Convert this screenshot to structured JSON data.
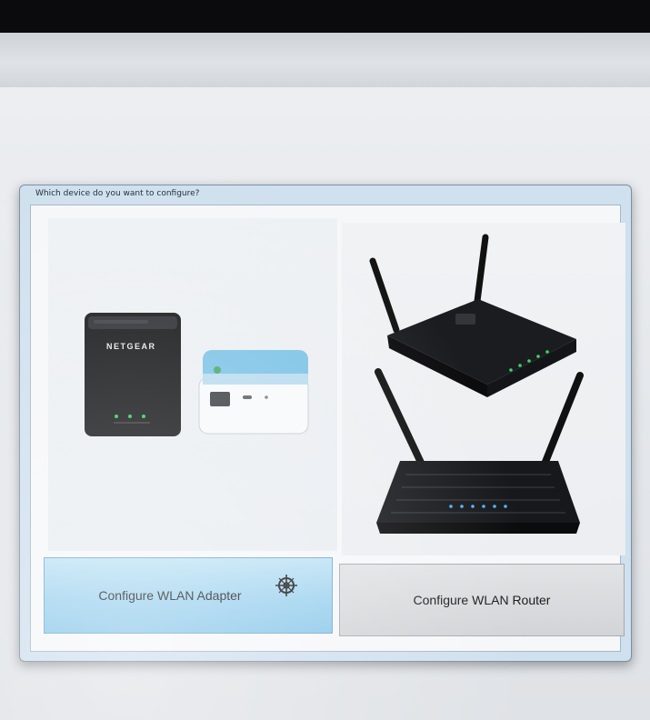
{
  "dialog": {
    "title": "Which device do you want to configure?"
  },
  "options": {
    "adapter_label": "Configure WLAN Adapter",
    "router_label": "Configure WLAN Router",
    "adapter_brand_text": "NETGEAR"
  },
  "icons": {
    "cursor": "busy-cursor-icon"
  },
  "colors": {
    "adapter_button": "#9ed2ef",
    "router_button": "#d2d4d7",
    "dialog_frame": "#cfe0ee"
  }
}
